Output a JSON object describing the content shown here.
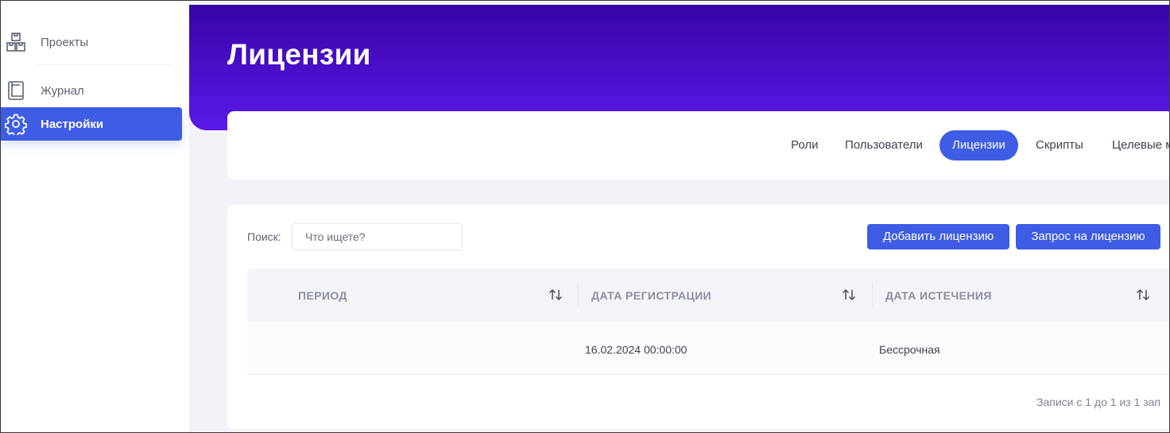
{
  "sidebar": {
    "items": [
      {
        "label": "Проекты",
        "icon": "boxes-icon",
        "active": false
      },
      {
        "label": "Журнал",
        "icon": "book-icon",
        "active": false
      },
      {
        "label": "Настройки",
        "icon": "gear-icon",
        "active": true
      }
    ]
  },
  "header": {
    "title": "Лицензии"
  },
  "tabs": [
    {
      "label": "Роли",
      "active": false
    },
    {
      "label": "Пользователи",
      "active": false
    },
    {
      "label": "Лицензии",
      "active": true
    },
    {
      "label": "Скрипты",
      "active": false
    },
    {
      "label": "Целевые м",
      "active": false
    }
  ],
  "search": {
    "label": "Поиск:",
    "placeholder": "Что ищете?",
    "value": ""
  },
  "toolbar": {
    "add_label": "Добавить лицензию",
    "request_label": "Запрос на лицензию"
  },
  "table": {
    "columns": [
      "ПЕРИОД",
      "ДАТА РЕГИСТРАЦИИ",
      "ДАТА ИСТЕЧЕНИЯ"
    ],
    "rows": [
      [
        "",
        "16.02.2024 00:00:00",
        "Бессрочная"
      ]
    ],
    "info": "Записи с 1 до 1 из 1 зап"
  },
  "colors": {
    "accent": "#3e5ce4",
    "hero_top": "#3804a6",
    "hero_bottom": "#5a19ea"
  }
}
